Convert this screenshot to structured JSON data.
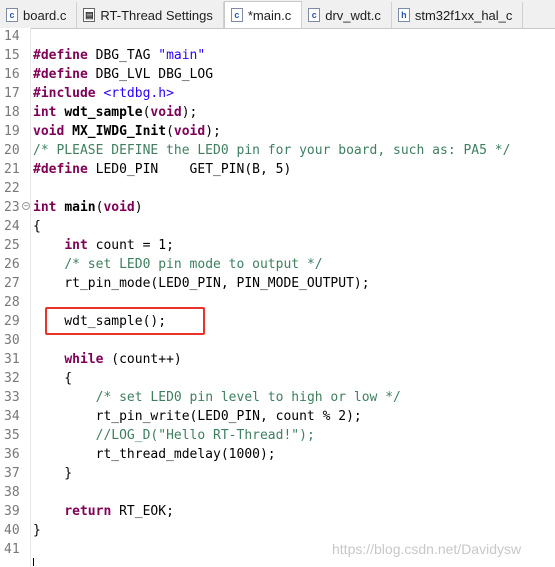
{
  "tabs": [
    {
      "label": "board.c",
      "icon": "c-file-icon"
    },
    {
      "label": "RT-Thread Settings",
      "icon": "settings-file-icon"
    },
    {
      "label": "*main.c",
      "icon": "c-file-icon",
      "active": true
    },
    {
      "label": "drv_wdt.c",
      "icon": "c-file-icon"
    },
    {
      "label": "stm32f1xx_hal_c",
      "icon": "h-file-icon"
    }
  ],
  "lines": [
    {
      "n": "14",
      "code": ""
    },
    {
      "n": "15",
      "code": "#define DBG_TAG \"main\""
    },
    {
      "n": "16",
      "code": "#define DBG_LVL DBG_LOG"
    },
    {
      "n": "17",
      "code": "#include <rtdbg.h>"
    },
    {
      "n": "18",
      "code": "int wdt_sample(void);"
    },
    {
      "n": "19",
      "code": "void MX_IWDG_Init(void);"
    },
    {
      "n": "20",
      "code": "/* PLEASE DEFINE the LED0 pin for your board, such as: PA5 */"
    },
    {
      "n": "21",
      "code": "#define LED0_PIN    GET_PIN(B, 5)"
    },
    {
      "n": "22",
      "code": ""
    },
    {
      "n": "23",
      "code": "int main(void)"
    },
    {
      "n": "24",
      "code": "{"
    },
    {
      "n": "25",
      "code": "    int count = 1;"
    },
    {
      "n": "26",
      "code": "    /* set LED0 pin mode to output */"
    },
    {
      "n": "27",
      "code": "    rt_pin_mode(LED0_PIN, PIN_MODE_OUTPUT);"
    },
    {
      "n": "28",
      "code": ""
    },
    {
      "n": "29",
      "code": "    wdt_sample();"
    },
    {
      "n": "30",
      "code": ""
    },
    {
      "n": "31",
      "code": "    while (count++)"
    },
    {
      "n": "32",
      "code": "    {"
    },
    {
      "n": "33",
      "code": "        /* set LED0 pin level to high or low */"
    },
    {
      "n": "34",
      "code": "        rt_pin_write(LED0_PIN, count % 2);"
    },
    {
      "n": "35",
      "code": "        //LOG_D(\"Hello RT-Thread!\");"
    },
    {
      "n": "36",
      "code": "        rt_thread_mdelay(1000);"
    },
    {
      "n": "37",
      "code": "    }"
    },
    {
      "n": "38",
      "code": ""
    },
    {
      "n": "39",
      "code": "    return RT_EOK;"
    },
    {
      "n": "40",
      "code": "}"
    },
    {
      "n": "41",
      "code": ""
    }
  ],
  "fold_marker": "⊖",
  "watermark": "https://blog.csdn.net/Davidysw",
  "colors": {
    "keyword": "#7f0055",
    "string": "#2a00ff",
    "comment": "#3f7f5f",
    "highlight_box": "#e8322a"
  }
}
